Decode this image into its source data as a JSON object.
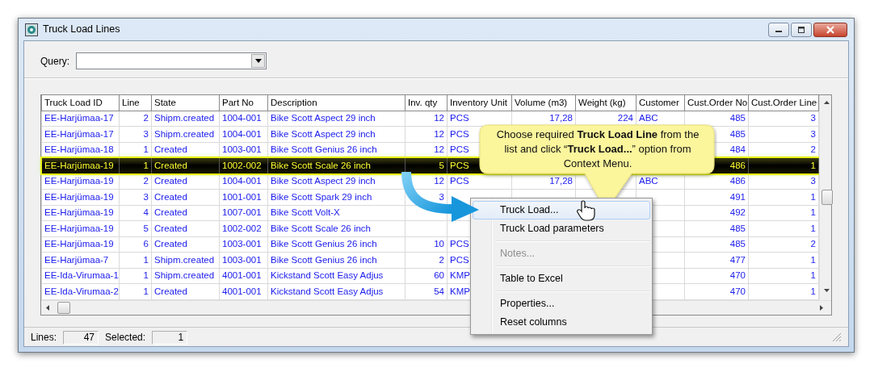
{
  "window": {
    "title": "Truck Load Lines"
  },
  "query": {
    "label": "Query:"
  },
  "table": {
    "columns": [
      {
        "label": "Truck Load ID",
        "kind": "text"
      },
      {
        "label": "Line",
        "kind": "number"
      },
      {
        "label": "State",
        "kind": "text"
      },
      {
        "label": "Part No",
        "kind": "text"
      },
      {
        "label": "Description",
        "kind": "text"
      },
      {
        "label": "Inv. qty",
        "kind": "number"
      },
      {
        "label": "Inventory Unit",
        "kind": "text"
      },
      {
        "label": "Volume (m3)",
        "kind": "number"
      },
      {
        "label": "Weight (kg)",
        "kind": "number"
      },
      {
        "label": "Customer",
        "kind": "text"
      },
      {
        "label": "Cust.Order No",
        "kind": "number"
      },
      {
        "label": "Cust.Order Line",
        "kind": "number"
      }
    ],
    "rows": [
      {
        "selected": false,
        "cells": [
          "EE-Harjümaa-17",
          "2",
          "Shipm.created",
          "1004-001",
          "Bike Scott Aspect 29 inch",
          "12",
          "PCS",
          "17,28",
          "224",
          "ABC",
          "485",
          "3"
        ]
      },
      {
        "selected": false,
        "cells": [
          "EE-Harjümaa-17",
          "3",
          "Shipm.created",
          "1004-001",
          "Bike Scott Aspect 29 inch",
          "12",
          "PCS",
          null,
          null,
          null,
          "485",
          "3"
        ]
      },
      {
        "selected": false,
        "cells": [
          "EE-Harjümaa-18",
          "1",
          "Created",
          "1003-001",
          "Bike Scott Genius 26 inch",
          "12",
          "PCS",
          null,
          null,
          null,
          "484",
          "2"
        ]
      },
      {
        "selected": true,
        "cells": [
          "EE-Harjümaa-19",
          "1",
          "Created",
          "1002-002",
          "Bike Scott Scale 26 inch",
          "5",
          "PCS",
          null,
          null,
          null,
          "486",
          "1"
        ]
      },
      {
        "selected": false,
        "cells": [
          "EE-Harjümaa-19",
          "2",
          "Created",
          "1004-001",
          "Bike Scott Aspect 29 inch",
          "12",
          "PCS",
          "17,28",
          null,
          "ABC",
          "486",
          "3"
        ]
      },
      {
        "selected": false,
        "cells": [
          "EE-Harjümaa-19",
          "3",
          "Created",
          "1001-001",
          "Bike Scott Spark 29 inch",
          "3",
          null,
          null,
          null,
          null,
          "491",
          "1"
        ]
      },
      {
        "selected": false,
        "cells": [
          "EE-Harjümaa-19",
          "4",
          "Created",
          "1007-001",
          "Bike Scott Volt-X",
          null,
          null,
          null,
          null,
          null,
          "492",
          "1"
        ]
      },
      {
        "selected": false,
        "cells": [
          "EE-Harjümaa-19",
          "5",
          "Created",
          "1002-002",
          "Bike Scott Scale 26 inch",
          null,
          null,
          null,
          null,
          null,
          "485",
          "1"
        ]
      },
      {
        "selected": false,
        "cells": [
          "EE-Harjümaa-19",
          "6",
          "Created",
          "1003-001",
          "Bike Scott Genius 26 inch",
          "10",
          "PCS",
          null,
          null,
          null,
          "485",
          "2"
        ]
      },
      {
        "selected": false,
        "cells": [
          "EE-Harjümaa-7",
          "1",
          "Shipm.created",
          "1003-001",
          "Bike Scott Genius 26 inch",
          "2",
          "PCS",
          null,
          null,
          null,
          "477",
          "1"
        ]
      },
      {
        "selected": false,
        "cells": [
          "EE-Ida-Virumaa-1",
          "1",
          "Shipm.created",
          "4001-001",
          "Kickstand Scott Easy Adjus",
          "60",
          "KMP",
          null,
          null,
          null,
          "470",
          "1"
        ]
      },
      {
        "selected": false,
        "cells": [
          "EE-Ida-Virumaa-2",
          "1",
          "Created",
          "4001-001",
          "Kickstand Scott Easy Adjus",
          "54",
          "KMP",
          null,
          null,
          null,
          "470",
          "1"
        ]
      }
    ]
  },
  "status_bar": [
    {
      "label": "Lines:",
      "value": "47"
    },
    {
      "label": "Selected:",
      "value": "1"
    }
  ],
  "callout": {
    "text": "Choose required **Truck Load Line** from the list and click “**Truck Load...**” option from Context Menu."
  },
  "context_menu": [
    {
      "kind": "item",
      "label": "Truck Load...",
      "selected": true,
      "disabled": false
    },
    {
      "kind": "item",
      "label": "Truck Load parameters",
      "selected": false,
      "disabled": false
    },
    {
      "kind": "separator"
    },
    {
      "kind": "item",
      "label": "Notes...",
      "selected": false,
      "disabled": true
    },
    {
      "kind": "separator"
    },
    {
      "kind": "item",
      "label": "Table to Excel",
      "selected": false,
      "disabled": false
    },
    {
      "kind": "separator"
    },
    {
      "kind": "item",
      "label": "Properties...",
      "selected": false,
      "disabled": false
    },
    {
      "kind": "item",
      "label": "Reset columns",
      "selected": false,
      "disabled": false
    }
  ]
}
